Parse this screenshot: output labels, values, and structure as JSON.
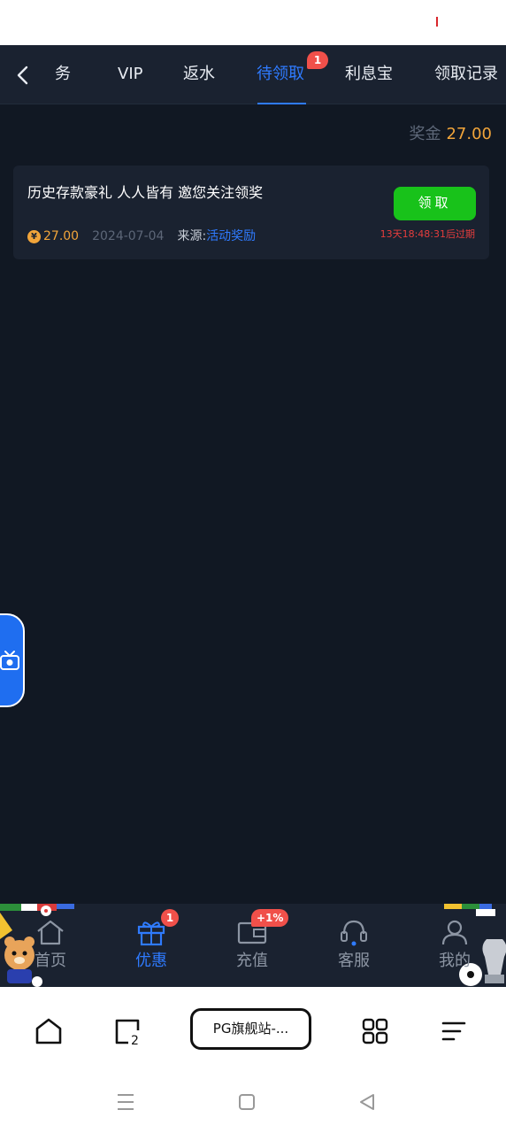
{
  "tabs": {
    "items": [
      {
        "label": "务"
      },
      {
        "label": "VIP"
      },
      {
        "label": "返水"
      },
      {
        "label": "待领取"
      },
      {
        "label": "利息宝"
      },
      {
        "label": "领取记录"
      }
    ],
    "active_badge": "1"
  },
  "bonus": {
    "label": "奖金",
    "value": "27.00"
  },
  "reward_card": {
    "title": "历史存款豪礼 人人皆有 邀您关注领奖",
    "coin_symbol": "¥",
    "amount": "27.00",
    "date": "2024-07-04",
    "source_label": "来源:",
    "source_value": "活动奖励",
    "claim_label": "领取",
    "expire_text": "13天18:48:31后过期"
  },
  "bottom_nav": {
    "items": [
      {
        "label": "首页",
        "icon": "home-icon"
      },
      {
        "label": "优惠",
        "icon": "gift-icon",
        "badge": "1"
      },
      {
        "label": "充值",
        "icon": "wallet-icon",
        "badge": "+1%"
      },
      {
        "label": "客服",
        "icon": "headset-icon"
      },
      {
        "label": "我的",
        "icon": "user-icon"
      }
    ]
  },
  "browser": {
    "url_label": "PG旗舰站-..."
  },
  "colors": {
    "background": "#111823",
    "panel": "#1a2230",
    "accent": "#2f7bff",
    "gold": "#f2a53a",
    "claim_green": "#18c21a",
    "alert_red": "#e63d3d"
  }
}
